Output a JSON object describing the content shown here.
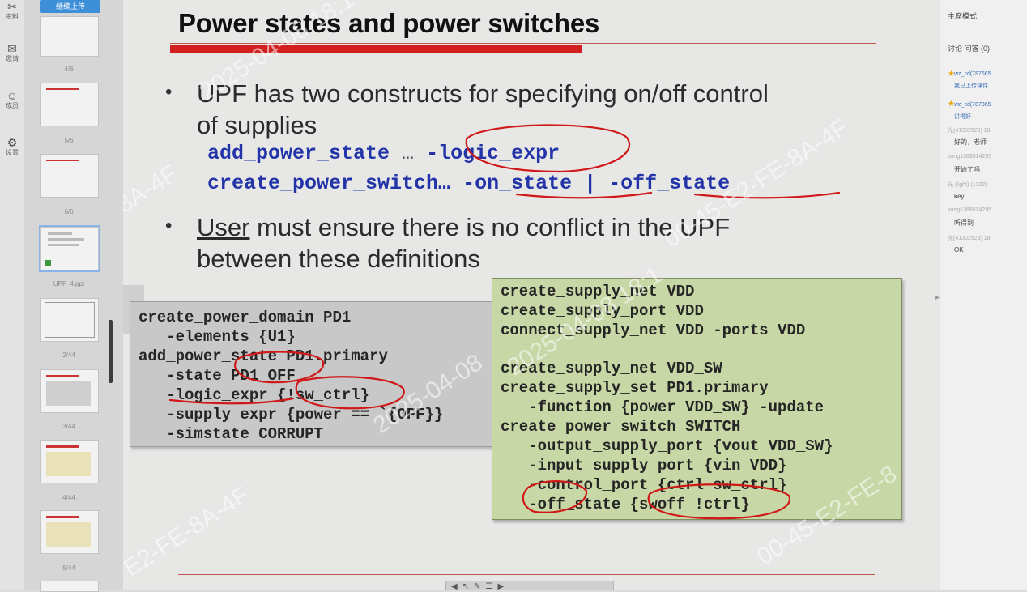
{
  "left_toolbar": {
    "items": [
      {
        "glyph": "✂",
        "label": "资料"
      },
      {
        "glyph": "✉",
        "label": "邀请"
      },
      {
        "glyph": "☺",
        "label": "成员"
      },
      {
        "glyph": "⚙",
        "label": "设置"
      }
    ]
  },
  "thumbnails": {
    "upload_label": "继续上传",
    "labels": [
      "4/6",
      "5/6",
      "6/6",
      "UPF_4.ppt",
      "2/44",
      "3/44",
      "4/44",
      "5/44"
    ]
  },
  "slide": {
    "title": "Power states and power switches",
    "bullet1_line1": "UPF has two constructs for specifying on/off control",
    "bullet1_line2": "of supplies",
    "code1_a": "add_power_state",
    "code1_b": " … ",
    "code1_c": "-logic_expr",
    "code2_a": "create_power_switch… ",
    "code2_b": "-on_state",
    "code2_c": " | ",
    "code2_d": "-off_state",
    "bullet2_user": "User",
    "bullet2_rest": " must ensure there is no conflict in the UPF",
    "bullet2_line2": "between these definitions",
    "left_code": [
      "create_power_domain PD1",
      "   -elements {U1}",
      "add_power_state PD1.primary",
      "   -state PD1_OFF",
      "   -logic_expr {!sw_ctrl}",
      "   -supply_expr {power == `{OFF}}",
      "   -simstate CORRUPT"
    ],
    "right_code": [
      "create_supply_net VDD",
      "create_supply_port VDD",
      "connect_supply_net VDD -ports VDD",
      "",
      "create_supply_net VDD_SW",
      "create_supply_set PD1.primary",
      "   -function {power VDD_SW} -update",
      "create_power_switch SWITCH",
      "   -output_supply_port {vout VDD_SW}",
      "   -input_supply_port {vin VDD}",
      "   -control_port {ctrl sw_ctrl}",
      "   -off_state {swoff !ctrl}"
    ]
  },
  "watermarks": [
    "2025-04-08 18:1",
    "-8A-4F",
    "2025-04-08 18:1",
    "00-45-E2-FE-8A-4F",
    "2025-04-08",
    "E2-FE-8A-4F",
    "00-45-E2-FE-8"
  ],
  "right_panel": {
    "mode_label": "主席模式",
    "tabs_label": "讨论  问答 (0)",
    "messages": [
      {
        "meta": "wz_cd(787665",
        "text": "我已上传课件"
      },
      {
        "meta": "wz_cd(787365",
        "text": "讲得好"
      },
      {
        "meta": "光(41302529) 18",
        "text": "好的，老师"
      },
      {
        "meta": "song1368514295",
        "text": "开始了吗"
      },
      {
        "meta": "光 (light) (1202)",
        "text": "keyi"
      },
      {
        "meta": "song1368514295",
        "text": "听得到"
      },
      {
        "meta": "光(41302529) 18",
        "text": "OK"
      }
    ]
  }
}
